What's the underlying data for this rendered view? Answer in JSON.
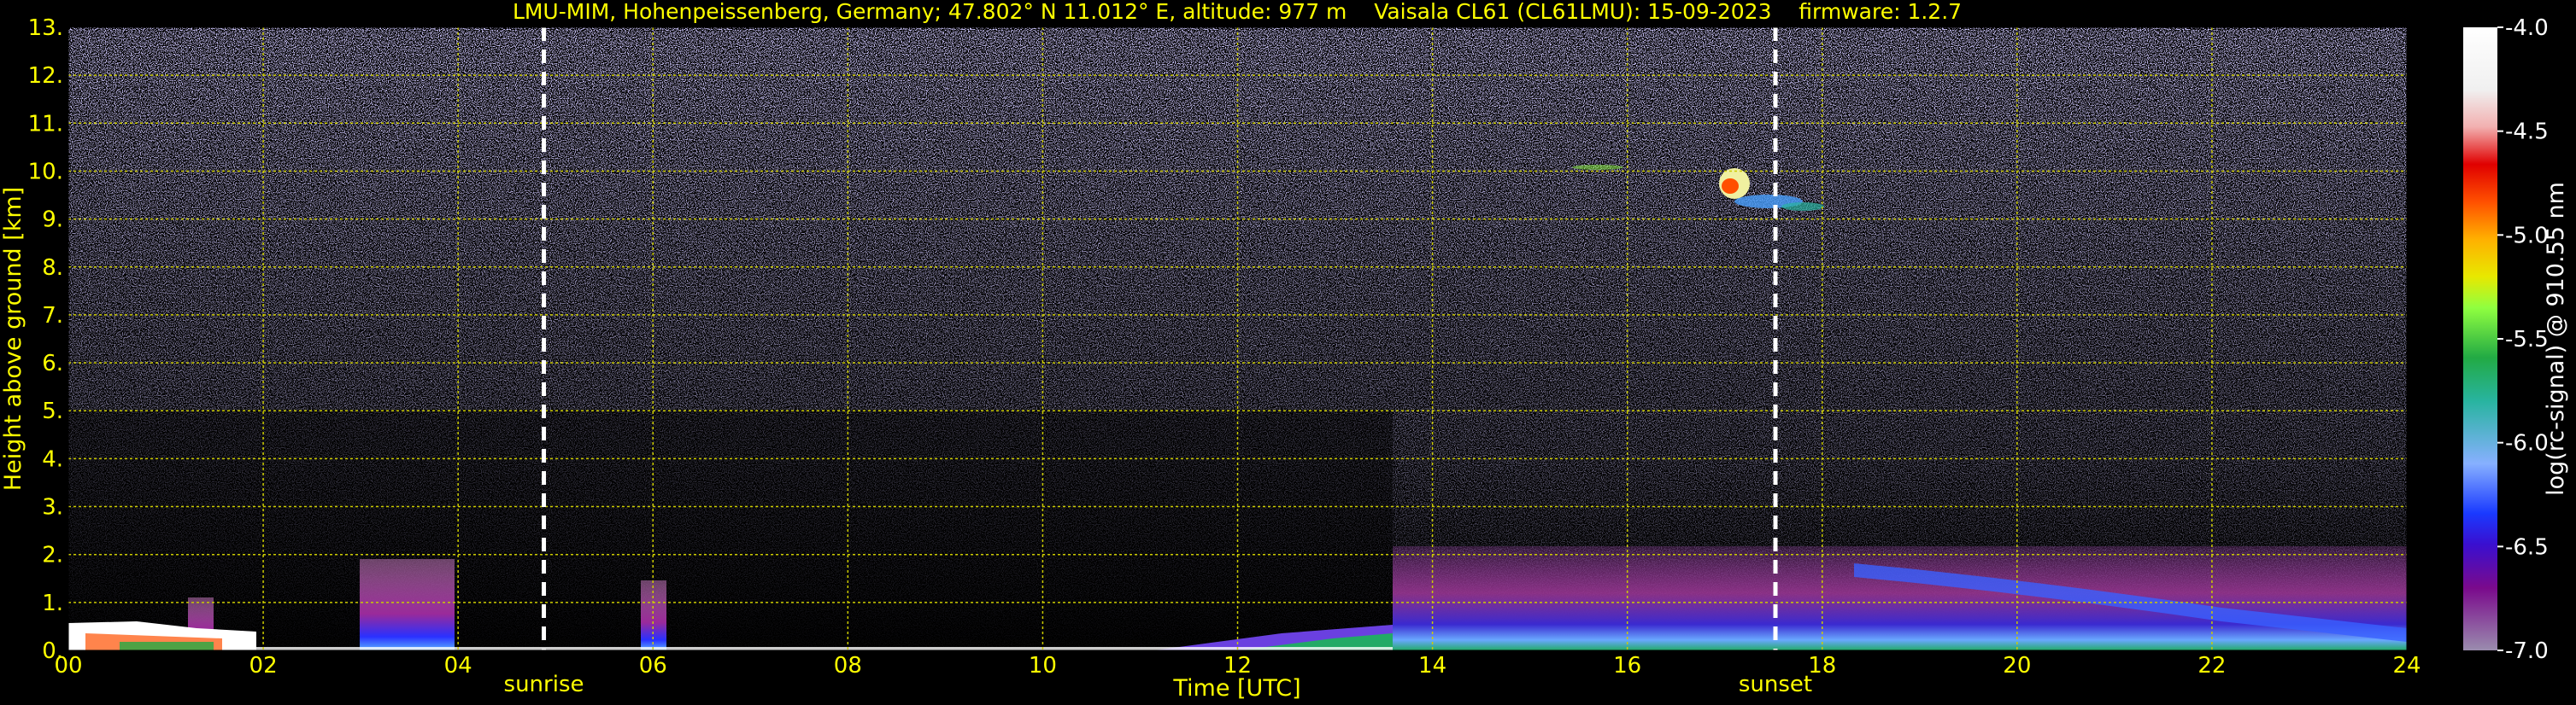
{
  "chart_data": {
    "type": "heatmap",
    "title": "LMU-MIM, Hohenpeissenberg, Germany; 47.802° N 11.012° E, altitude: 977 m    Vaisala CL61 (CL61LMU): 15-09-2023    firmware: 1.2.7",
    "xlabel": "Time [UTC]",
    "ylabel": "Height above ground [km]",
    "xlim": [
      0,
      24
    ],
    "ylim": [
      0,
      13
    ],
    "x_ticks": [
      "00",
      "02",
      "04",
      "06",
      "08",
      "10",
      "12",
      "14",
      "16",
      "18",
      "20",
      "22",
      "24"
    ],
    "y_ticks": [
      "0.",
      "1.",
      "2.",
      "3.",
      "4.",
      "5.",
      "6.",
      "7.",
      "8.",
      "9.",
      "10.",
      "11.",
      "12.",
      "13."
    ],
    "grid": true,
    "annotations": [
      {
        "text": "sunrise",
        "x": 4.88
      },
      {
        "text": "sunset",
        "x": 17.52
      }
    ],
    "colorbar": {
      "label": "log(rc-signal) @ 910.55 nm",
      "range": [
        -7.0,
        -4.0
      ],
      "ticks": [
        "-4.0",
        "-4.5",
        "-5.0",
        "-5.5",
        "-6.0",
        "-6.5",
        "-7.0"
      ]
    },
    "features": [
      {
        "name": "boundary layer",
        "x_range": [
          13.6,
          24
        ],
        "top_km": 2.0
      },
      {
        "name": "cirrus cloud",
        "x_range": [
          16.8,
          17.8
        ],
        "height_km": 9.6
      },
      {
        "name": "low aerosol patch",
        "x_range": [
          3.0,
          4.0
        ],
        "top_km": 1.8
      }
    ]
  },
  "colors": {
    "text": "#ffff00",
    "grid": "#cccc00",
    "background": "#000000",
    "noise": "#8a7ad6",
    "colormap": [
      "#9a8cae",
      "#7a0a8c",
      "#3a0fd0",
      "#1a3aff",
      "#4aa0ff",
      "#87b0ff",
      "#28b4a0",
      "#22aa44",
      "#90ff40",
      "#e8e800",
      "#ffb000",
      "#ff5000",
      "#e00000",
      "#f2b0b0",
      "#ffffff"
    ]
  }
}
